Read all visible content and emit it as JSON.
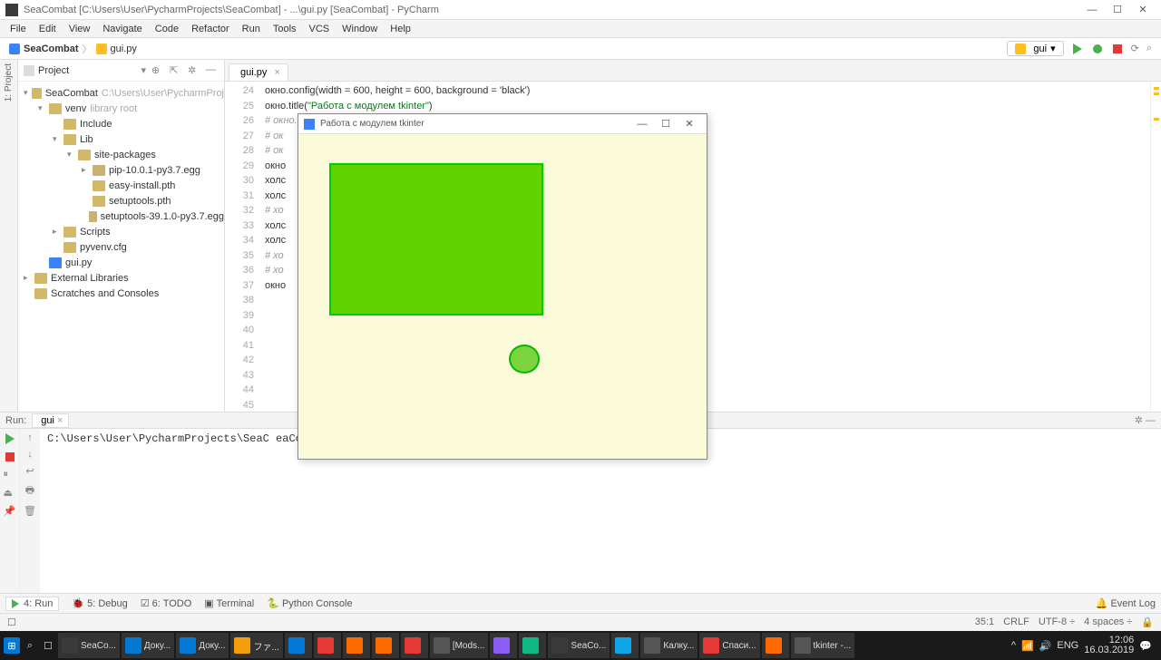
{
  "window": {
    "title": "SeaCombat [C:\\Users\\User\\PycharmProjects\\SeaCombat] - ...\\gui.py [SeaCombat] - PyCharm"
  },
  "menubar": [
    "File",
    "Edit",
    "View",
    "Navigate",
    "Code",
    "Refactor",
    "Run",
    "Tools",
    "VCS",
    "Window",
    "Help"
  ],
  "breadcrumb": {
    "root": "SeaCombat",
    "file": "gui.py"
  },
  "runcfg": {
    "name": "gui"
  },
  "project": {
    "title": "Project",
    "tree": [
      {
        "indent": 0,
        "arrow": "▾",
        "icon": "folder",
        "text": "SeaCombat",
        "gray": "C:\\Users\\User\\PycharmProj"
      },
      {
        "indent": 1,
        "arrow": "▾",
        "icon": "folder",
        "text": "venv",
        "gray": "library root"
      },
      {
        "indent": 2,
        "arrow": "",
        "icon": "folder",
        "text": "Include"
      },
      {
        "indent": 2,
        "arrow": "▾",
        "icon": "folder",
        "text": "Lib"
      },
      {
        "indent": 3,
        "arrow": "▾",
        "icon": "folder",
        "text": "site-packages"
      },
      {
        "indent": 4,
        "arrow": "▸",
        "icon": "pkg",
        "text": "pip-10.0.1-py3.7.egg"
      },
      {
        "indent": 4,
        "arrow": "",
        "icon": "txt",
        "text": "easy-install.pth"
      },
      {
        "indent": 4,
        "arrow": "",
        "icon": "txt",
        "text": "setuptools.pth"
      },
      {
        "indent": 4,
        "arrow": "",
        "icon": "pkg",
        "text": "setuptools-39.1.0-py3.7.egg"
      },
      {
        "indent": 2,
        "arrow": "▸",
        "icon": "folder",
        "text": "Scripts"
      },
      {
        "indent": 2,
        "arrow": "",
        "icon": "txt",
        "text": "pyvenv.cfg"
      },
      {
        "indent": 1,
        "arrow": "",
        "icon": "pyf",
        "text": "gui.py"
      },
      {
        "indent": 0,
        "arrow": "▸",
        "icon": "folder",
        "text": "External Libraries"
      },
      {
        "indent": 0,
        "arrow": "",
        "icon": "folder",
        "text": "Scratches and Consoles"
      }
    ]
  },
  "tab": {
    "name": "gui.py"
  },
  "lines_start": 24,
  "code": [
    {
      "t": "окно.config(width = 600, height = 600, background = 'black')",
      "cls": ""
    },
    {
      "t": "окно.title(\"Работа с модулем tkinter\")",
      "cls": ""
    },
    {
      "t": "# окно.resizable(0,0)",
      "cls": "comment"
    },
    {
      "t": "# ок",
      "cls": "comment"
    },
    {
      "t": "# ок",
      "cls": "comment"
    },
    {
      "t": "",
      "cls": ""
    },
    {
      "t": "окно",
      "cls": ""
    },
    {
      "t": "",
      "cls": ""
    },
    {
      "t": "",
      "cls": ""
    },
    {
      "t": "холс",
      "cls": ""
    },
    {
      "t": "холс",
      "cls": ""
    },
    {
      "t": "",
      "cls": "hl-row"
    },
    {
      "t": "",
      "cls": ""
    },
    {
      "t": "# хо                                              (100, 2))",
      "cls": "comment"
    },
    {
      "t": "холс                                              \"овал\")",
      "cls": ""
    },
    {
      "t": "холс                                     3, outline = \"#0F0\")",
      "cls": ""
    },
    {
      "t": "# хо                                              red\")",
      "cls": "comment"
    },
    {
      "t": "# хо                                     tags = \"овал\")",
      "cls": "comment"
    },
    {
      "t": "",
      "cls": ""
    },
    {
      "t": "",
      "cls": ""
    },
    {
      "t": "окно",
      "cls": ""
    },
    {
      "t": "",
      "cls": ""
    }
  ],
  "run": {
    "label": "Run:",
    "tab": "gui",
    "output": "C:\\Users\\User\\PycharmProjects\\SeaC                                    eaCombat/gui.py"
  },
  "bottom": {
    "run": "4: Run",
    "debug": "5: Debug",
    "todo": "6: TODO",
    "terminal": "Terminal",
    "console": "Python Console",
    "eventlog": "Event Log"
  },
  "status": {
    "pos": "35:1",
    "crlf": "CRLF",
    "enc": "UTF-8",
    "indent": "4 spaces"
  },
  "tkinter": {
    "title": "Работа с модулем tkinter"
  },
  "taskbar": {
    "items": [
      "SeaCo...",
      "Доку...",
      "Доку...",
      "ファ...",
      "",
      "",
      "",
      "",
      "",
      "[Mods...",
      "",
      "",
      "SeaCo...",
      "",
      "Калку...",
      "Спаси...",
      "",
      "tkinter -..."
    ],
    "lang": "ENG",
    "time": "12:06",
    "date": "16.03.2019"
  }
}
